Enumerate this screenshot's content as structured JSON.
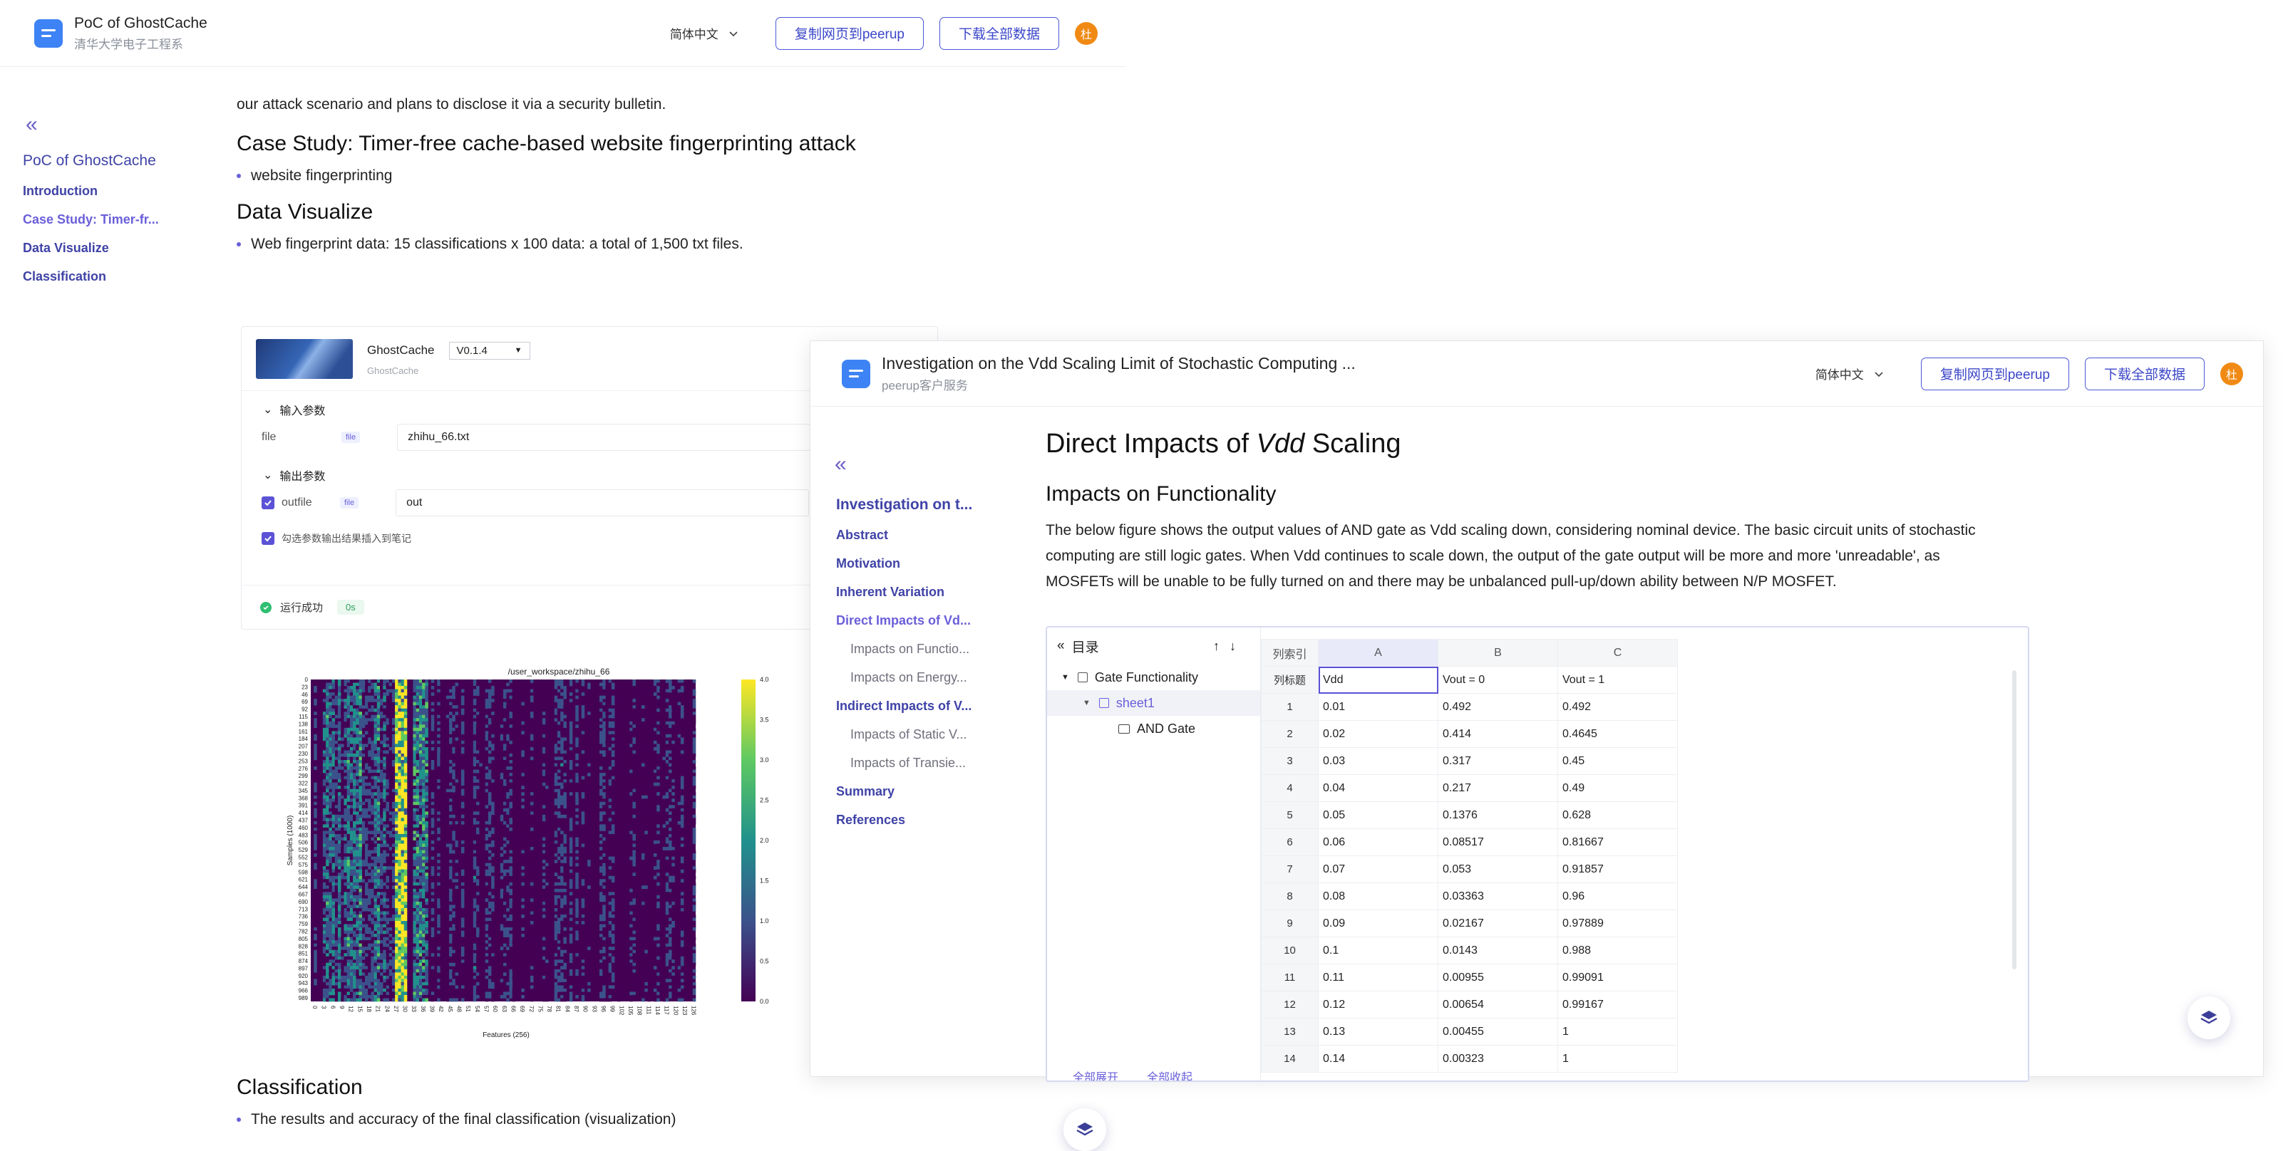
{
  "window1": {
    "header": {
      "title": "PoC of GhostCache",
      "subtitle": "清华大学电子工程系",
      "language": "简体中文",
      "copy_button": "复制网页到peerup",
      "download_button": "下载全部数据",
      "avatar": "杜"
    },
    "sidebar": {
      "title": "PoC of GhostCache",
      "items": [
        "Introduction",
        "Case Study: Timer-fr...",
        "Data Visualize",
        "Classification"
      ]
    },
    "content": {
      "intro_tail": "our attack scenario and plans to disclose it via a security bulletin.",
      "case_study_heading": "Case Study: Timer-free cache-based website fingerprinting attack",
      "case_study_bullet": "website fingerprinting",
      "data_visualize_heading": "Data Visualize",
      "data_visualize_bullet": "Web fingerprint data: 15 classifications x 100 data: a total of 1,500 txt files.",
      "classification_heading": "Classification",
      "classification_bullet": "The results and accuracy of the final classification (visualization)"
    },
    "tool": {
      "name": "GhostCache",
      "org": "GhostCache",
      "version": "V0.1.4",
      "input_section": "输入参数",
      "input_label": "file",
      "input_tag": "file",
      "input_value": "zhihu_66.txt",
      "output_section": "输出参数",
      "output_label": "outfile",
      "output_tag": "file",
      "output_value": "out",
      "insert_checkbox": "勾选参数输出结果插入到笔记",
      "status": "运行成功",
      "duration": "0s"
    },
    "heatmap": {
      "title": "/user_workspace/zhihu_66",
      "xlabel": "Features (256)",
      "ylabel": "Samples (1000)",
      "colorbar_ticks": [
        "4.0",
        "3.5",
        "3.0",
        "2.5",
        "2.0",
        "1.5",
        "1.0",
        "0.5",
        "0.0"
      ],
      "colors": [
        "#440154",
        "#3b528b",
        "#21918c",
        "#5ec962",
        "#fde725"
      ]
    }
  },
  "window2": {
    "header": {
      "title": "Investigation on the Vdd Scaling Limit of Stochastic Computing ...",
      "subtitle": "peerup客户服务",
      "language": "简体中文",
      "copy_button": "复制网页到peerup",
      "download_button": "下载全部数据",
      "avatar": "杜"
    },
    "sidebar": {
      "title": "Investigation on t...",
      "items": [
        {
          "label": "Abstract",
          "sub": false
        },
        {
          "label": "Motivation",
          "sub": false
        },
        {
          "label": "Inherent Variation",
          "sub": false
        },
        {
          "label": "Direct Impacts of Vd...",
          "sub": false,
          "active": true
        },
        {
          "label": "Impacts on Functio...",
          "sub": true
        },
        {
          "label": "Impacts on Energy...",
          "sub": true
        },
        {
          "label": "Indirect Impacts of V...",
          "sub": false
        },
        {
          "label": "Impacts of Static V...",
          "sub": true
        },
        {
          "label": "Impacts of Transie...",
          "sub": true
        },
        {
          "label": "Summary",
          "sub": false
        },
        {
          "label": "References",
          "sub": false
        }
      ]
    },
    "content": {
      "heading_prefix": "Direct Impacts of ",
      "heading_em": "Vdd",
      "heading_suffix": " Scaling",
      "subheading": "Impacts on Functionality",
      "paragraph": "The below figure shows the output values of AND gate as Vdd scaling down, considering nominal device. The basic circuit units of stochastic computing are still logic gates. When Vdd continues to scale down, the output of the gate output will be more and more 'unreadable', as MOSFETs will be unable to be fully turned on and there may be unbalanced pull-up/down ability between N/P MOSFET."
    },
    "spreadsheet": {
      "toc_title": "目录",
      "tree": [
        "Gate Functionality",
        "sheet1",
        "AND Gate"
      ],
      "footer": [
        "全部展开",
        "全部收起"
      ],
      "index_label": "列索引",
      "header_label": "列标题",
      "columns": [
        "A",
        "B",
        "C"
      ],
      "column_titles": [
        "Vdd",
        "Vout = 0",
        "Vout = 1"
      ],
      "rows": [
        [
          "1",
          "0.01",
          "0.492",
          "0.492"
        ],
        [
          "2",
          "0.02",
          "0.414",
          "0.4645"
        ],
        [
          "3",
          "0.03",
          "0.317",
          "0.45"
        ],
        [
          "4",
          "0.04",
          "0.217",
          "0.49"
        ],
        [
          "5",
          "0.05",
          "0.1376",
          "0.628"
        ],
        [
          "6",
          "0.06",
          "0.08517",
          "0.81667"
        ],
        [
          "7",
          "0.07",
          "0.053",
          "0.91857"
        ],
        [
          "8",
          "0.08",
          "0.03363",
          "0.96"
        ],
        [
          "9",
          "0.09",
          "0.02167",
          "0.97889"
        ],
        [
          "10",
          "0.1",
          "0.0143",
          "0.988"
        ],
        [
          "11",
          "0.11",
          "0.00955",
          "0.99091"
        ],
        [
          "12",
          "0.12",
          "0.00654",
          "0.99167"
        ],
        [
          "13",
          "0.13",
          "0.00455",
          "1"
        ],
        [
          "14",
          "0.14",
          "0.00323",
          "1"
        ]
      ]
    }
  }
}
